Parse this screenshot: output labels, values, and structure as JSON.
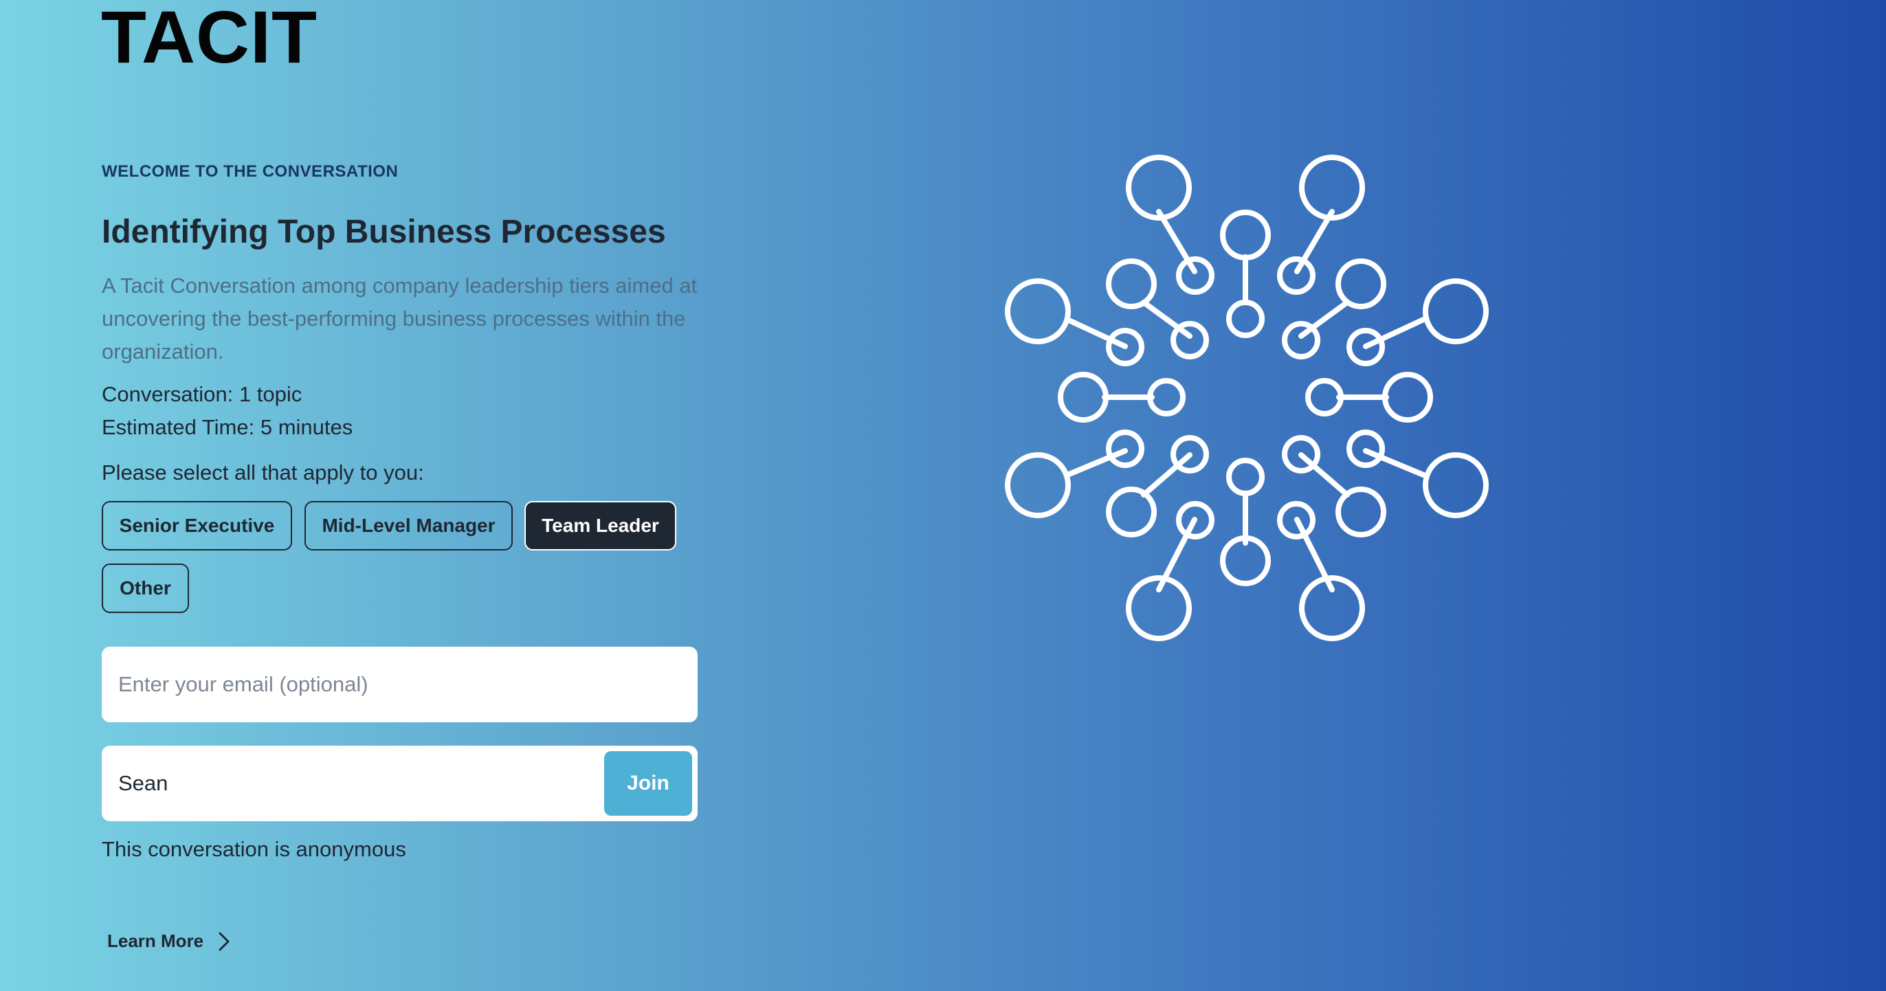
{
  "brand": {
    "logo_text": "TACIT"
  },
  "intro": {
    "eyebrow": "WELCOME TO THE CONVERSATION",
    "title": "Identifying Top Business Processes",
    "description": "A Tacit Conversation among company leadership tiers aimed at uncovering the best-performing business processes within the organization.",
    "topics": "Conversation: 1 topic",
    "time": "Estimated Time: 5 minutes"
  },
  "roles": {
    "prompt": "Please select all that apply to you:",
    "options": [
      {
        "label": "Senior Executive",
        "selected": false
      },
      {
        "label": "Mid-Level Manager",
        "selected": false
      },
      {
        "label": "Team Leader",
        "selected": true
      },
      {
        "label": "Other",
        "selected": false
      }
    ]
  },
  "form": {
    "email_placeholder": "Enter your email (optional)",
    "email_value": "",
    "name_value": "Sean",
    "join_label": "Join",
    "anonymous_note": "This conversation is anonymous"
  },
  "footer": {
    "learn_more_label": "Learn More",
    "learn_more_icon": "chevron-right-icon"
  },
  "illustration": {
    "icon": "network-molecule-icon",
    "color": "#ffffff"
  },
  "colors": {
    "gradient_start": "#7ad3e3",
    "gradient_end": "#1f4ba8",
    "selected_chip": "#1f2733",
    "join_button": "#4fb0d6"
  }
}
